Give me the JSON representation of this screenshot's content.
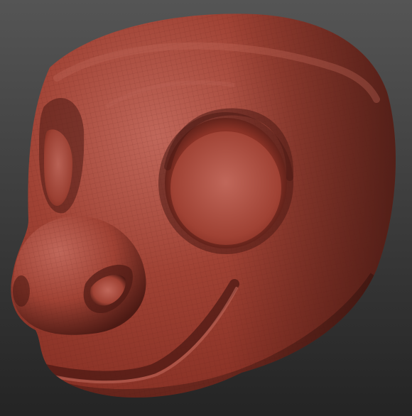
{
  "scene": {
    "subject": "sculpted-cartoon-creature-head",
    "colors": {
      "background_top": "#555555",
      "background_bottom": "#242424",
      "clay_base": "#8a3226",
      "clay_light": "#c0675a",
      "clay_mid": "#a04234",
      "clay_dark": "#4d1a14",
      "mesh_line": "#5a1c14"
    }
  }
}
